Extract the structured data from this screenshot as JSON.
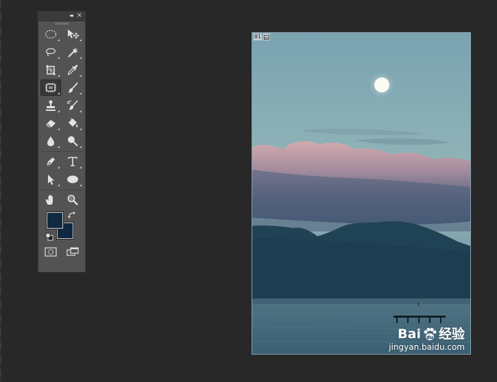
{
  "panel": {
    "collapse_glyph": "◂◂",
    "close_glyph": "×"
  },
  "tools": [
    [
      "elliptical-marquee",
      "move"
    ],
    [
      "lasso",
      "magic-wand"
    ],
    [
      "crop-perspective",
      "eyedropper"
    ],
    [
      "content-aware",
      "brush"
    ],
    [
      "clone-stamp",
      "history-brush"
    ],
    [
      "eraser",
      "paint-bucket"
    ],
    [
      "blur",
      "dodge"
    ],
    [
      "pen",
      "type"
    ],
    [
      "path-selection",
      "ellipse"
    ],
    [
      "hand",
      "zoom"
    ]
  ],
  "colors": {
    "foreground": "#0f2a40",
    "background": "#0f2a40"
  },
  "document": {
    "badge_number": "01"
  },
  "watermark": {
    "logo_text": "Bai",
    "logo_text_2": "du",
    "logo_suffix": "经验",
    "url": "jingyan.baidu.com"
  }
}
